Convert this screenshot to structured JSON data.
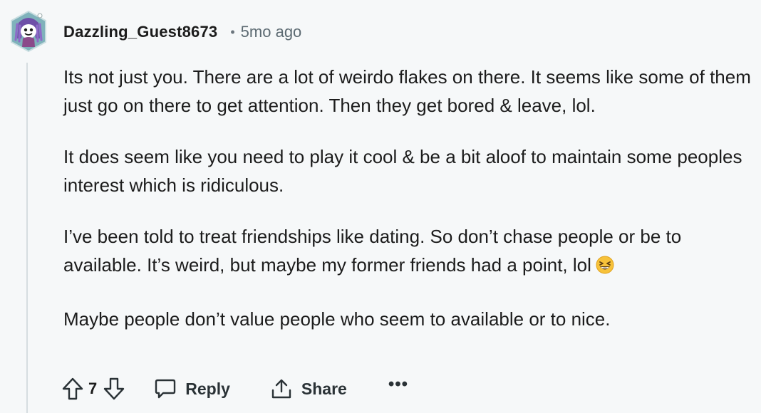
{
  "comment": {
    "author": "Dazzling_Guest8673",
    "separator": "•",
    "timestamp": "5mo ago",
    "paragraphs": [
      "Its not just you. There are a lot of weirdo flakes on there. It seems like some of them just go on there to get attention. Then they get bored & leave, lol.",
      "It does seem like you need to play it cool & be a bit aloof to maintain some peoples interest which is ridiculous.",
      "I’ve been told to treat friendships like dating. So don’t chase people or be to available. It’s weird, but maybe my former friends had a point, lol",
      "Maybe people don’t value people who seem to available or to nice."
    ],
    "emoji": "laughing-squinting-face"
  },
  "actions": {
    "vote_count": "7",
    "reply_label": "Reply",
    "share_label": "Share",
    "more_label": "•••"
  },
  "icons": {
    "upvote": "upvote-arrow-icon",
    "downvote": "downvote-arrow-icon",
    "reply": "comment-bubble-icon",
    "share": "share-upload-icon"
  },
  "colors": {
    "background": "#f6f8f9",
    "thread_line": "#d6dde1",
    "avatar_bg": "#7fb2bb",
    "avatar_hair": "#7b5bb4",
    "text": "#1c1c1c",
    "muted": "#5c6a72"
  }
}
